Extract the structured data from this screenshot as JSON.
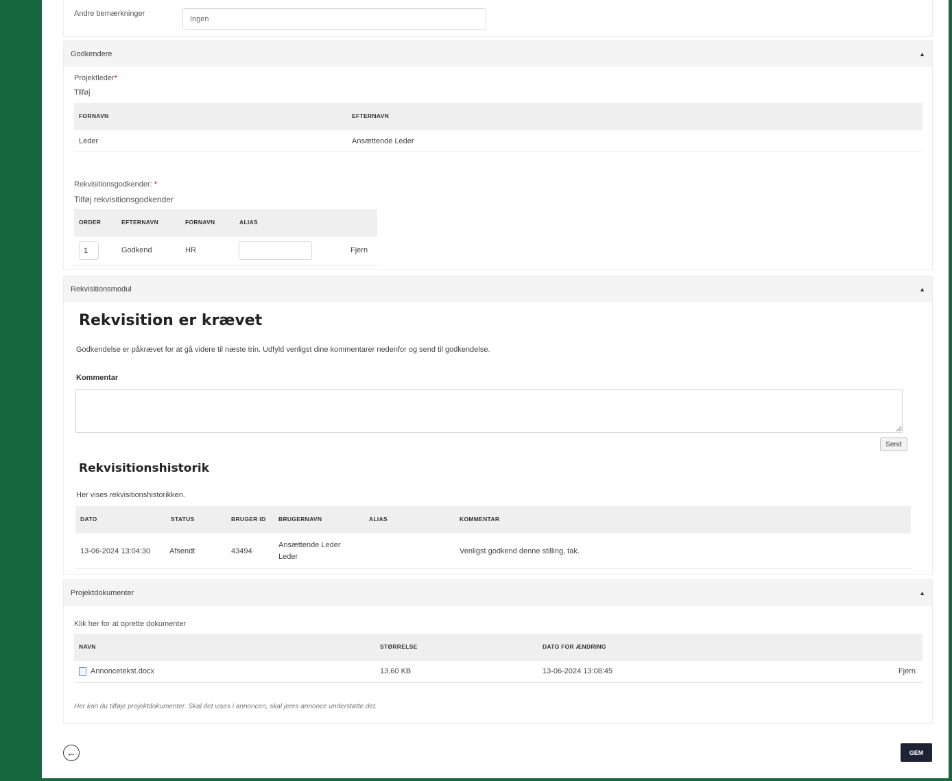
{
  "remarks": {
    "label": "Andre bemærkninger",
    "value": "Ingen"
  },
  "approvers": {
    "header": "Godkendere",
    "project_leader_label": "Projektleder",
    "required_mark": "*",
    "add_link": "Tilføj",
    "columns": [
      "FORNAVN",
      "EFTERNAVN"
    ],
    "rows": [
      {
        "first": "Leder",
        "last": "Ansættende Leder"
      }
    ],
    "req_label": "Rekvisitionsgodkender:",
    "req_add_link": "Tilføj rekvisitionsgodkender",
    "req_columns": [
      "ORDER",
      "EFTERNAVN",
      "FORNAVN",
      "ALIAS"
    ],
    "req_rows": [
      {
        "order": "1",
        "last": "Godkend",
        "first": "HR",
        "alias": "",
        "remove": "Fjern"
      }
    ]
  },
  "requisition": {
    "header": "Rekvisitionsmodul",
    "title": "Rekvisition er krævet",
    "description": "Godkendelse er påkrævet for at gå videre til næste trin. Udfyld venligst dine kommentarer nedenfor og send til godkendelse.",
    "comment_label": "Kommentar",
    "comment_value": "",
    "send_label": "Send",
    "history_title": "Rekvisitionshistorik",
    "history_desc": "Her vises rekvisitionshistorikken.",
    "history_columns": [
      "DATO",
      "STATUS",
      "BRUGER ID",
      "BRUGERNAVN",
      "ALIAS",
      "KOMMENTAR"
    ],
    "history_rows": [
      {
        "date": "13-06-2024 13:04:30",
        "status": "Afsendt",
        "user_id": "43494",
        "username_line1": "Ansættende Leder",
        "username_line2": "Leder",
        "alias": "",
        "comment": "Venligst godkend denne stilling, tak."
      }
    ]
  },
  "documents": {
    "header": "Projektdokumenter",
    "create_link": "Klik her for at oprette dokumenter",
    "columns": [
      "NAVN",
      "STØRRELSE",
      "DATO FOR ÆNDRING"
    ],
    "rows": [
      {
        "icon": "document-icon",
        "name": "Annoncetekst.docx",
        "size": "13,60 KB",
        "modified": "13-06-2024 13:08:45",
        "remove": "Fjern"
      }
    ],
    "note": "Her kan du tilføje projektdokumenter. Skal det vises i annoncen, skal jeres annonce understøtte det."
  },
  "footer": {
    "back_icon": "arrow-left-circle-icon",
    "save_label": "GEM"
  },
  "colors": {
    "background": "#17683f",
    "save_button": "#1e2235",
    "required": "#d0021b"
  }
}
